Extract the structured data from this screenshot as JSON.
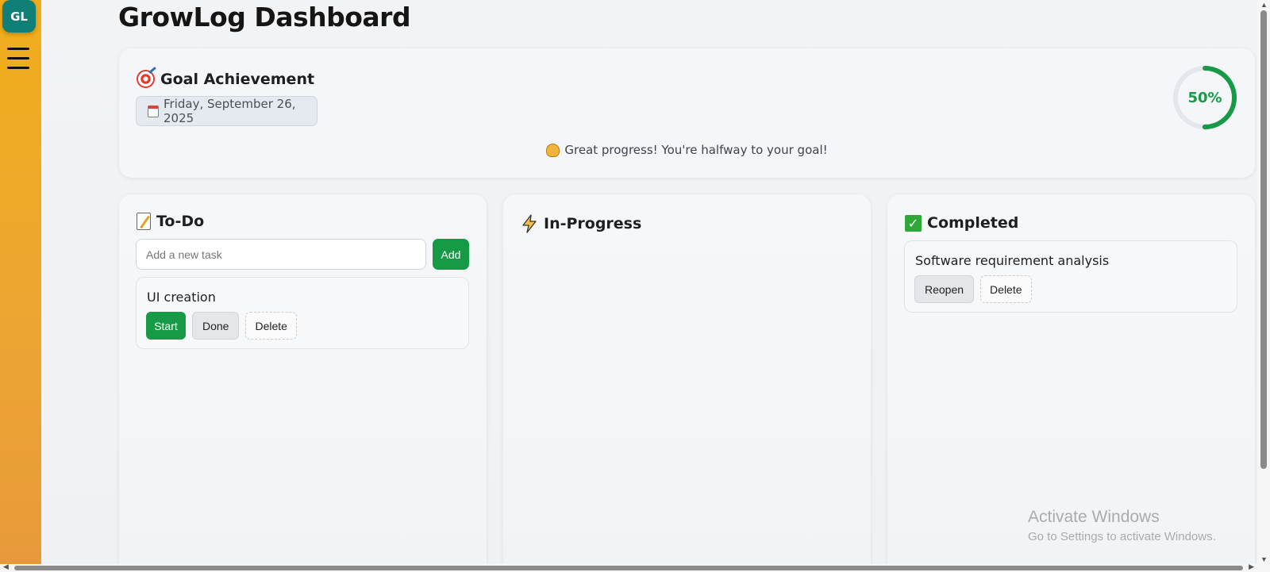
{
  "app": {
    "logo_text": "GL",
    "page_title": "GrowLog Dashboard"
  },
  "goal": {
    "title": "Goal Achievement",
    "date": "Friday, September 26, 2025",
    "percent_label": "50%",
    "percent_value": 0.5,
    "message": "Great progress! You're halfway to your goal!"
  },
  "columns": {
    "todo": {
      "title": "To-Do",
      "input_placeholder": "Add a new task",
      "add_label": "Add",
      "tasks": [
        {
          "name": "UI creation",
          "start_label": "Start",
          "done_label": "Done",
          "delete_label": "Delete"
        }
      ]
    },
    "in_progress": {
      "title": "In-Progress"
    },
    "completed": {
      "title": "Completed",
      "tasks": [
        {
          "name": "Software requirement analysis",
          "reopen_label": "Reopen",
          "delete_label": "Delete"
        }
      ]
    }
  },
  "watermark": {
    "line1": "Activate Windows",
    "line2": "Go to Settings to activate Windows."
  },
  "colors": {
    "accent_green": "#169a45",
    "sidebar_top": "#f0ae1a",
    "sidebar_bottom": "#e89a3a",
    "logo_bg": "#0f7f78"
  },
  "icons": {
    "goal": "target-icon",
    "date": "calendar-icon",
    "message": "flexed-biceps-icon",
    "todo": "memo-icon",
    "in_progress": "lightning-icon",
    "completed": "check-mark-icon",
    "menu": "hamburger-menu-icon"
  }
}
